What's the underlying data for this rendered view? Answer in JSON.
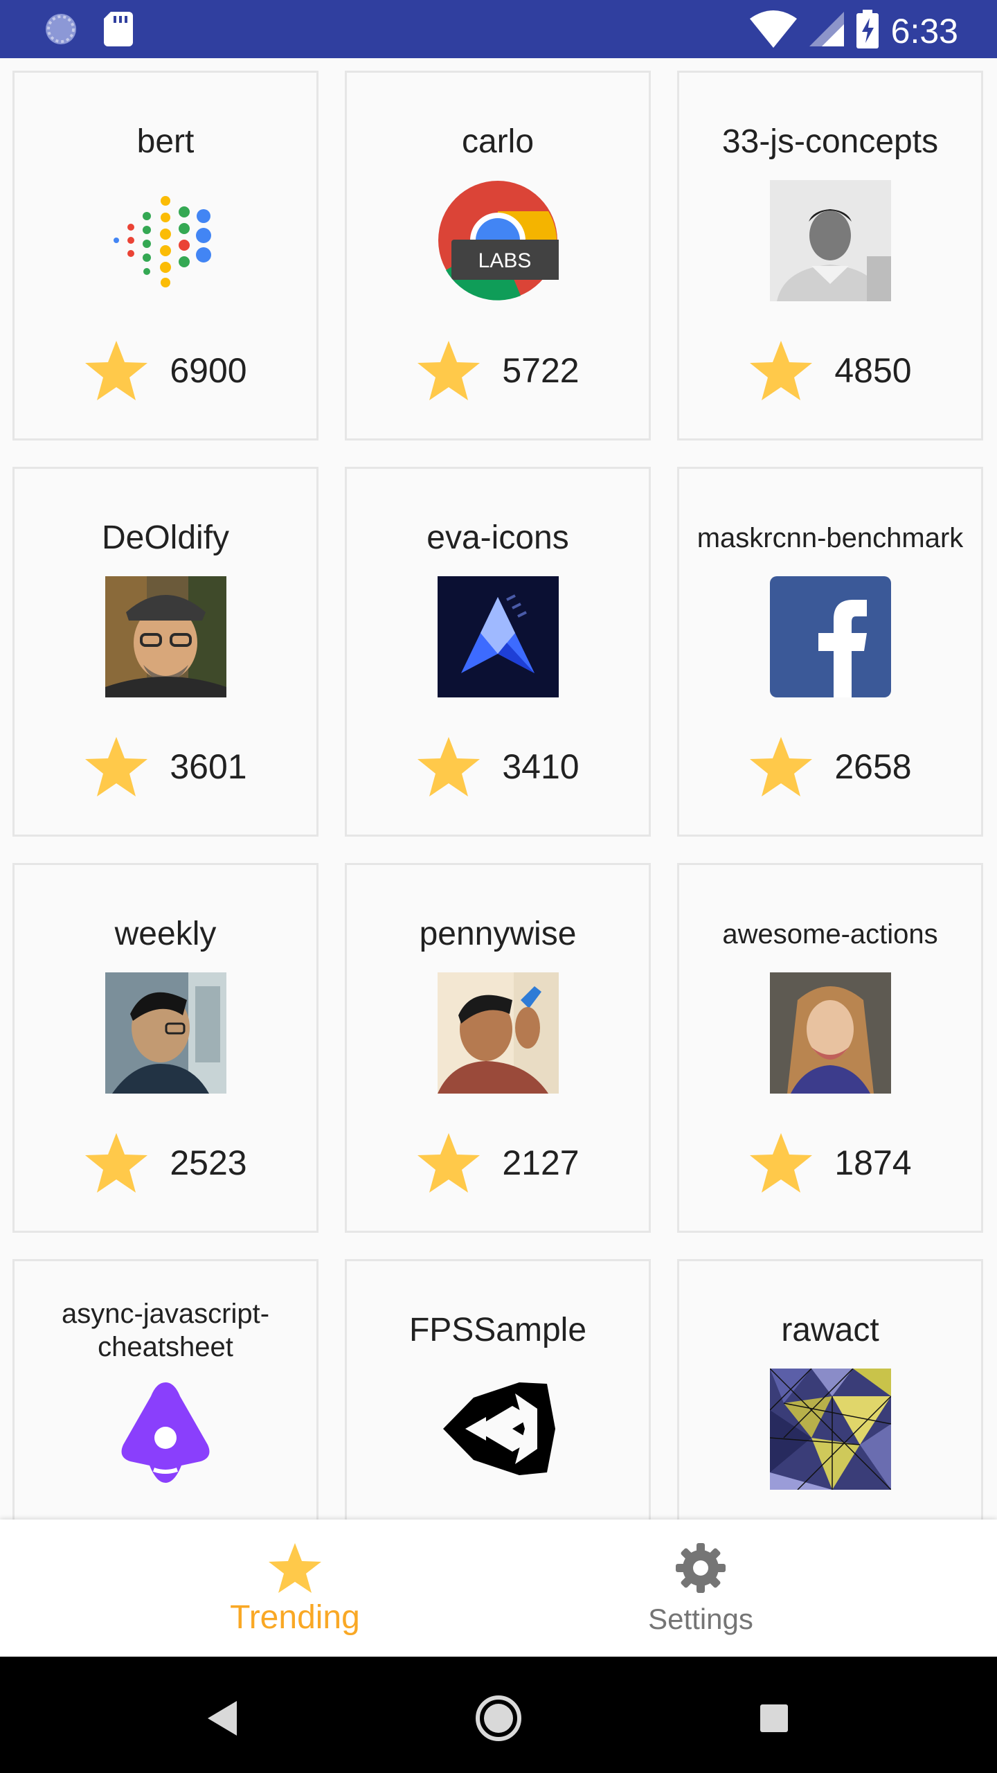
{
  "status_bar": {
    "time": "6:33",
    "icons": [
      "sync-icon",
      "sd-card-icon",
      "wifi-icon",
      "cell-signal-icon",
      "battery-charging-icon"
    ],
    "background": "#303F9F"
  },
  "repos": [
    {
      "name": "bert",
      "stars": "6900",
      "avatar": "google-dots-logo"
    },
    {
      "name": "carlo",
      "stars": "5722",
      "avatar": "chrome-labs-logo",
      "avatar_badge": "LABS"
    },
    {
      "name": "33-js-concepts",
      "stars": "4850",
      "avatar": "user-photo-bw"
    },
    {
      "name": "DeOldify",
      "stars": "3601",
      "avatar": "user-photo-painted"
    },
    {
      "name": "eva-icons",
      "stars": "3410",
      "avatar": "eva-logo"
    },
    {
      "name": "maskrcnn-benchmark",
      "stars": "2658",
      "avatar": "facebook-logo"
    },
    {
      "name": "weekly",
      "stars": "2523",
      "avatar": "user-photo-profile"
    },
    {
      "name": "pennywise",
      "stars": "2127",
      "avatar": "user-photo-portrait"
    },
    {
      "name": "awesome-actions",
      "stars": "1874",
      "avatar": "user-photo-woman"
    },
    {
      "name": "async-javascript-cheatsheet",
      "stars": "",
      "avatar": "purple-triangle-logo"
    },
    {
      "name": "FPSSample",
      "stars": "",
      "avatar": "unity-logo"
    },
    {
      "name": "rawact",
      "stars": "",
      "avatar": "low-poly-pattern"
    }
  ],
  "bottom_nav": {
    "trending_label": "Trending",
    "settings_label": "Settings",
    "active": "Trending",
    "active_color": "#F9A825",
    "inactive_color": "#757575"
  },
  "colors": {
    "star": "#FFC94A",
    "card_border": "#e6e6e6",
    "card_bg": "#fafafa"
  }
}
